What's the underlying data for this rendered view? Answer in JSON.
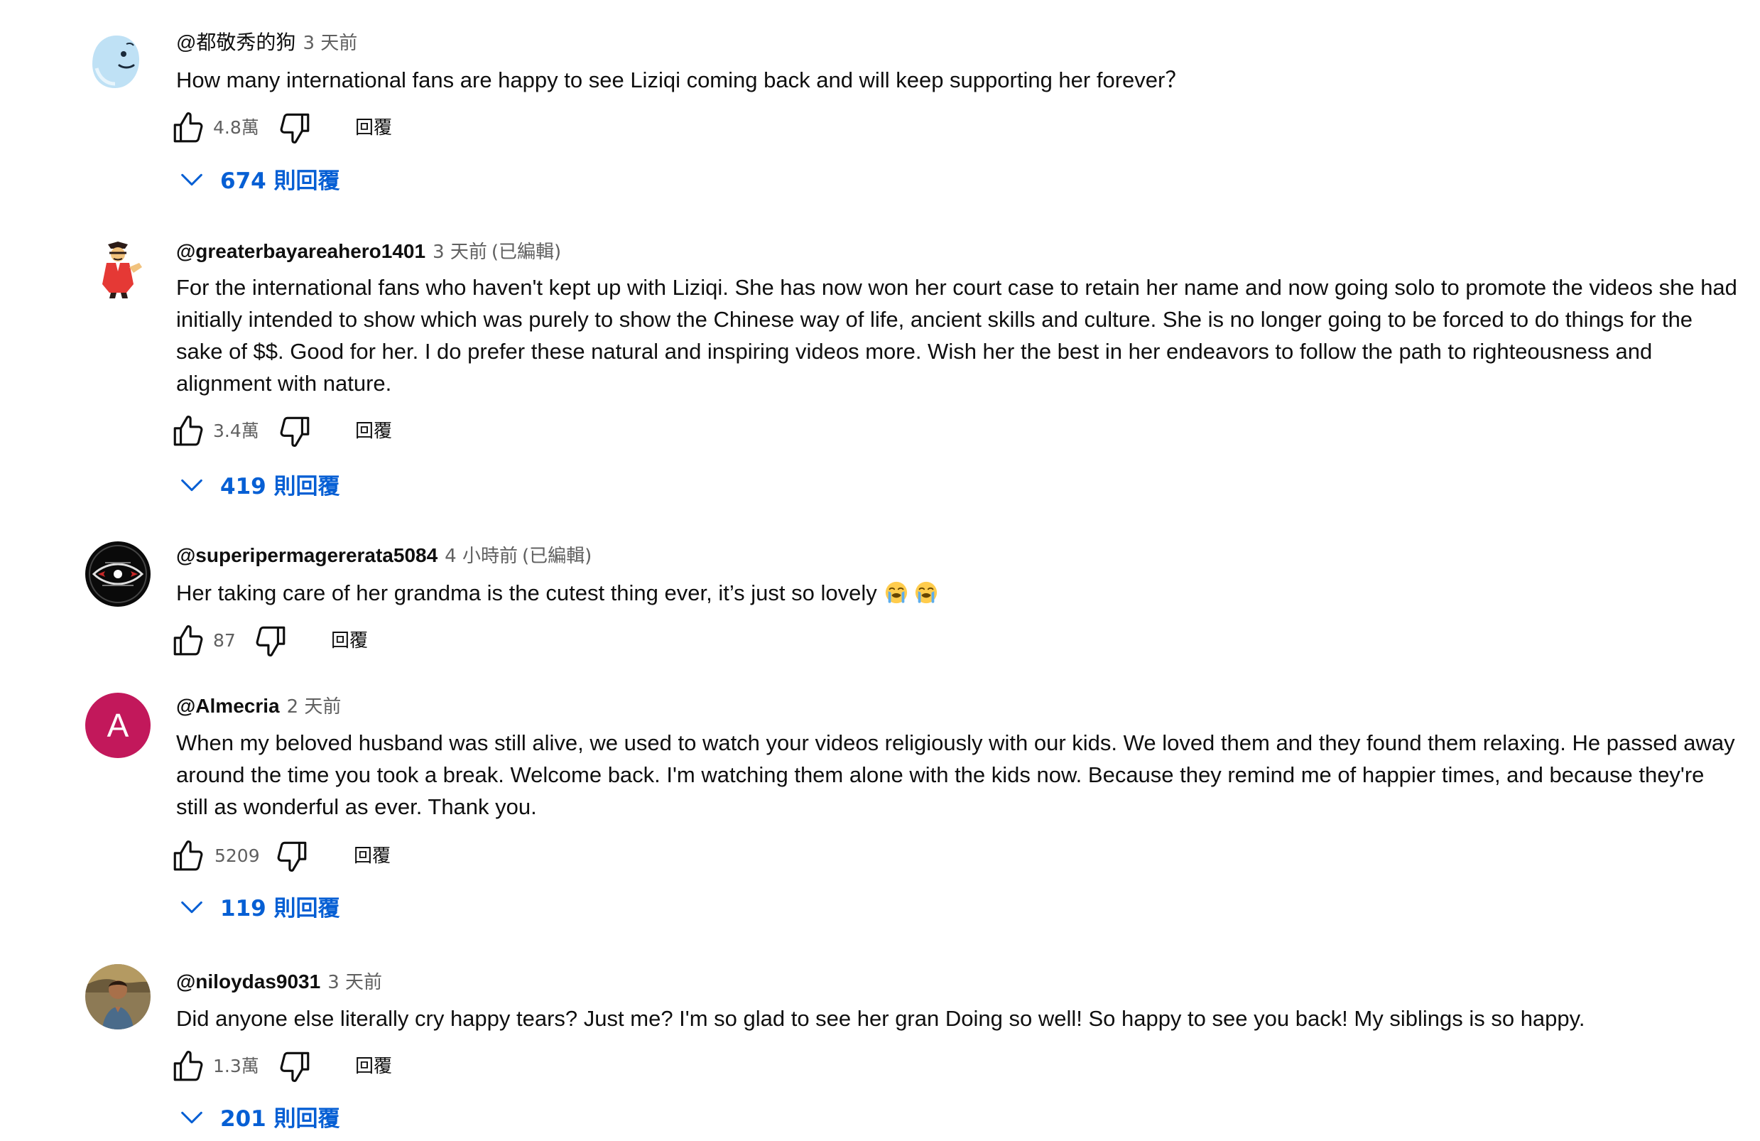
{
  "comments": [
    {
      "author": "@都敬秀的狗",
      "time": "3 天前",
      "edited": "",
      "text": "How many international fans are happy to see Liziqi coming back and will keep supporting her forever？",
      "likes": "4.8萬",
      "reply_label": "回覆",
      "replies": "674 則回覆",
      "avatar": "cartoon-face-avatar"
    },
    {
      "author": "@greaterbayareahero1401",
      "time": "3 天前",
      "edited": "(已編輯)",
      "text": "For the international fans who haven't kept up with Liziqi. She has now won her court case to retain her name and now going solo to promote the videos she had initially intended to show which was purely to show the Chinese way of life, ancient skills and culture. She is no longer going to be forced to do things for the sake of $$. Good for her. I do prefer these natural and inspiring videos more. Wish her the best in her endeavors to follow the path to righteousness and alignment with nature.",
      "likes": "3.4萬",
      "reply_label": "回覆",
      "replies": "419 則回覆",
      "avatar": "cartoon-man-avatar"
    },
    {
      "author": "@superipermagererata5084",
      "time": "4 小時前",
      "edited": "(已編輯)",
      "text": "Her taking care of her grandma is the cutest thing ever, it’s just so lovely",
      "emoji": [
        "loudly-crying-face-emoji",
        "loudly-crying-face-emoji"
      ],
      "likes": "87",
      "reply_label": "回覆",
      "replies": "",
      "avatar": "dark-logo-avatar"
    },
    {
      "author": "@Almecria",
      "time": "2 天前",
      "edited": "",
      "text": "When my beloved husband was still alive, we used to watch your videos religiously with our kids. We loved them and they found them relaxing. He passed away around the time you took a break. Welcome back. I'm watching them alone with the kids now. Because they remind me of happier times, and because they're still as wonderful as ever. Thank you.",
      "likes": "5209",
      "reply_label": "回覆",
      "replies": "119 則回覆",
      "avatar": "A",
      "avatar_color": "#c2185b"
    },
    {
      "author": "@niloydas9031",
      "time": "3 天前",
      "edited": "",
      "text": "Did anyone else literally cry happy tears? Just me? I'm so glad to see her gran Doing so well!  So happy to see you back! My siblings is so happy.",
      "likes": "1.3萬",
      "reply_label": "回覆",
      "replies": "201 則回覆",
      "avatar": "photo-avatar"
    }
  ],
  "icons": {
    "like": "thumb-up-icon",
    "dislike": "thumb-down-icon",
    "expand": "chevron-down-icon"
  },
  "colors": {
    "link_blue": "#065fd4",
    "meta_gray": "#606060",
    "text": "#0f0f0f"
  }
}
